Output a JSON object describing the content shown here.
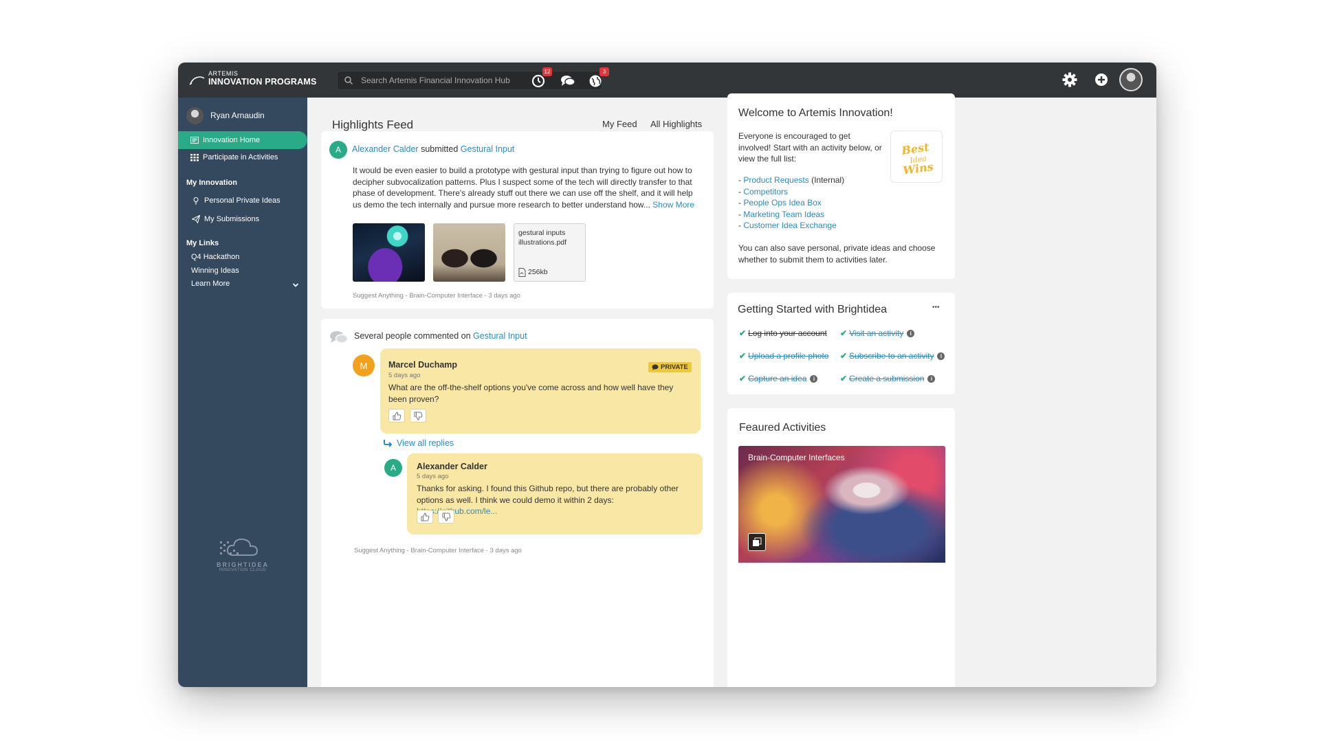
{
  "app": {
    "logo_small": "ARTEMIS",
    "logo_big": "INNOVATION PROGRAMS"
  },
  "topbar": {
    "search_placeholder": "Search Artemis Financial Innovation Hub",
    "notifications_badge": "12",
    "globe_badge": "3",
    "icons": [
      "notifications-icon",
      "chat-icon",
      "globe-icon",
      "gear-icon",
      "add-icon",
      "avatar"
    ]
  },
  "sidebar": {
    "user_name": "Ryan Arnaudin",
    "nav": [
      {
        "label": "Innovation Home",
        "icon": "innovation-home-icon",
        "active": true
      },
      {
        "label": "Participate in Activities",
        "icon": "grid-icon",
        "active": false
      }
    ],
    "my_innovation": {
      "heading": "My Innovation",
      "items": [
        {
          "label": "Personal Private Ideas",
          "icon": "lightbulb-icon"
        },
        {
          "label": "My Submissions",
          "icon": "paper-plane-icon"
        }
      ]
    },
    "my_links": {
      "heading": "My Links",
      "items": [
        "Q4 Hackathon",
        "Winning Ideas",
        "Learn More"
      ]
    },
    "footer": {
      "word": "BRIGHTIDEA",
      "sub": "INNOVATION CLOUD"
    }
  },
  "feed": {
    "title": "Highlights Feed",
    "tabs": [
      {
        "label": "My Feed",
        "active": true
      },
      {
        "label": "All Highlights",
        "active": false
      }
    ],
    "post": {
      "avatar_letter": "A",
      "author": "Alexander Calder",
      "verb": "submitted",
      "idea": "Gestural Input",
      "body": "It would be even easier to build a prototype with gestural input than trying to figure out how to decipher subvocalization patterns. Plus I suspect some of the tech will directly transfer to that phase of development. There's already stuff out there we can use off the shelf, and it will help us demo the tech internally and pursue more research to better understand how...",
      "show_more": "Show More",
      "attachment": {
        "name": "gestural inputs illustrations.pdf",
        "size": "256kb"
      },
      "meta": "Suggest Anything - Brain-Computer Interface - 3 days ago"
    },
    "comments": {
      "header_text": "Several people commented on",
      "header_link": "Gestural Input",
      "comment1": {
        "avatar_letter": "M",
        "name": "Marcel Duchamp",
        "time": "5 days ago",
        "private_label": "PRIVATE",
        "text": "What are the off-the-shelf options you've come across and how well have they been proven?"
      },
      "view_replies": "View all replies",
      "reply": {
        "avatar_letter": "A",
        "name": "Alexander Calder",
        "time": "5 days ago",
        "text": "Thanks for asking. I found this Github repo, but there are probably other options as well. I think we could demo it within 2 days:",
        "link": "https://github.com/le..."
      },
      "meta": "Suggest Anything - Brain-Computer Interface - 3 days ago"
    }
  },
  "welcome": {
    "title": "Welcome to Artemis Innovation!",
    "intro": "Everyone is encouraged to get involved! Start with an activity below, or view the full list:",
    "links": [
      {
        "label": "Product Requests",
        "suffix": " (Internal)"
      },
      {
        "label": "Competitors",
        "suffix": ""
      },
      {
        "label": "People Ops Idea Box",
        "suffix": ""
      },
      {
        "label": "Marketing Team Ideas",
        "suffix": ""
      },
      {
        "label": "Customer Idea Exchange",
        "suffix": ""
      }
    ],
    "outro": "You can also save personal, private ideas and choose whether to submit them to activities later.",
    "badge_text": "Best Idea Wins"
  },
  "getting_started": {
    "title": "Getting Started with Brightidea",
    "menu": "•••",
    "items": [
      {
        "label": "Log into your account",
        "link": false,
        "info": false
      },
      {
        "label": "Visit an activity",
        "link": true,
        "info": true
      },
      {
        "label": "Upload a profile photo",
        "link": true,
        "info": false
      },
      {
        "label": "Subscribe to an activity",
        "link": true,
        "info": true
      },
      {
        "label": "Capture an idea",
        "link": true,
        "info": true
      },
      {
        "label": "Create a submission",
        "link": true,
        "info": true
      }
    ]
  },
  "featured": {
    "title": "Feaured Activities",
    "card_title": "Brain-Computer Interfaces"
  },
  "colors": {
    "topbar": "#333638",
    "sidebar": "#34485e",
    "accent_green": "#29ab87",
    "link_blue": "#2a8bc7",
    "bubble_yellow": "#f9e7a5",
    "badge_red": "#e0363b"
  }
}
